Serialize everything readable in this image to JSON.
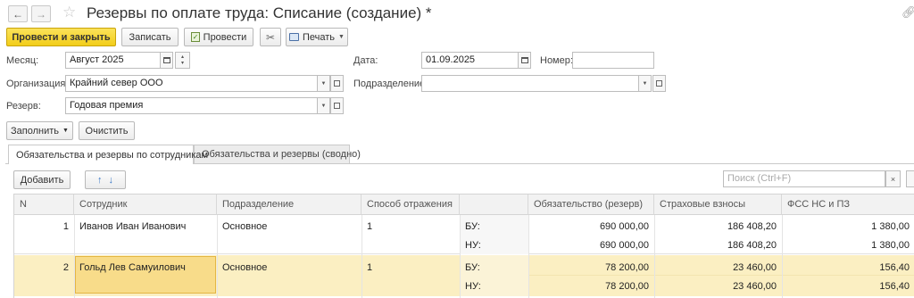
{
  "window": {
    "title": "Резервы по оплате труда: Списание (создание) *"
  },
  "icons": {
    "back": "arrow-left-icon",
    "forward": "arrow-right-icon",
    "favorite": "star-icon",
    "link": "link-icon"
  },
  "toolbar": {
    "post_close_label": "Провести и закрыть",
    "save_label": "Записать",
    "post_label": "Провести",
    "print_label": "Печать"
  },
  "form": {
    "month_label": "Месяц:",
    "month_value": "Август 2025",
    "date_label": "Дата:",
    "date_value": "01.09.2025",
    "number_label": "Номер:",
    "number_value": "",
    "org_label": "Организация:",
    "org_value": "Крайний север ООО",
    "division_label": "Подразделение:",
    "division_value": "",
    "reserve_label": "Резерв:",
    "reserve_value": "Годовая премия"
  },
  "actions": {
    "fill_label": "Заполнить",
    "clear_label": "Очистить"
  },
  "tabs": [
    {
      "label": "Обязательства и резервы по сотрудникам",
      "active": true
    },
    {
      "label": "Обязательства и резервы (сводно)",
      "active": false
    }
  ],
  "table_toolbar": {
    "add_label": "Добавить",
    "search_placeholder": "Поиск (Ctrl+F)",
    "clear_symbol": "×"
  },
  "table": {
    "columns": [
      "N",
      "Сотрудник",
      "Подразделение",
      "Способ отражения",
      "",
      "Обязательство (резерв)",
      "Страховые взносы",
      "ФСС НС и ПЗ"
    ],
    "rows": [
      {
        "n": "1",
        "employee": "Иванов Иван Иванович",
        "division": "Основное",
        "method": "1",
        "bu_label": "БУ:",
        "nu_label": "НУ:",
        "bu": {
          "obligation": "690 000,00",
          "insurance": "186 408,20",
          "fss": "1 380,00"
        },
        "nu": {
          "obligation": "690 000,00",
          "insurance": "186 408,20",
          "fss": "1 380,00"
        }
      },
      {
        "n": "2",
        "employee": "Гольд Лев Самуилович",
        "division": "Основное",
        "method": "1",
        "bu_label": "БУ:",
        "nu_label": "НУ:",
        "bu": {
          "obligation": "78 200,00",
          "insurance": "23 460,00",
          "fss": "156,40"
        },
        "nu": {
          "obligation": "78 200,00",
          "insurance": "23 460,00",
          "fss": "156,40"
        }
      }
    ]
  },
  "colors": {
    "primary_button": "#f2cd1a",
    "selected_row": "#fbefc2",
    "selected_cell": "#f8dc8a"
  }
}
